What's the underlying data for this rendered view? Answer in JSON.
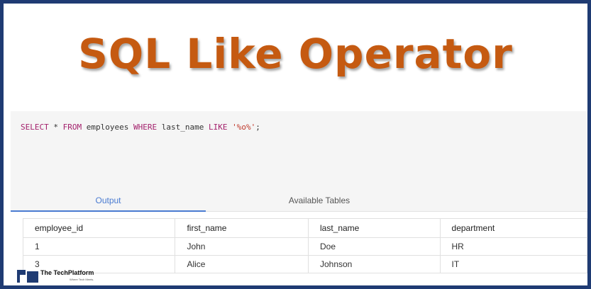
{
  "title": "SQL Like Operator",
  "editor": {
    "kw_select": "SELECT",
    "star": " * ",
    "kw_from": "FROM",
    "table": " employees ",
    "kw_where": "WHERE",
    "column": " last_name ",
    "kw_like": "LIKE",
    "space": " ",
    "pattern": "'%o%'",
    "terminator": ";"
  },
  "tabs": [
    {
      "label": "Output",
      "active": true
    },
    {
      "label": "Available Tables",
      "active": false
    }
  ],
  "table": {
    "headers": [
      "employee_id",
      "first_name",
      "last_name",
      "department"
    ],
    "rows": [
      [
        "1",
        "John",
        "Doe",
        "HR"
      ],
      [
        "3",
        "Alice",
        "Johnson",
        "IT"
      ]
    ]
  },
  "logo": {
    "name": "The TechPlatform",
    "tagline": "Where Tech Meets."
  },
  "colors": {
    "frame": "#1f3b73",
    "title": "#c55a11",
    "keyword": "#a31f6b",
    "string": "#c0392b",
    "active_tab": "#4a7bd1"
  }
}
